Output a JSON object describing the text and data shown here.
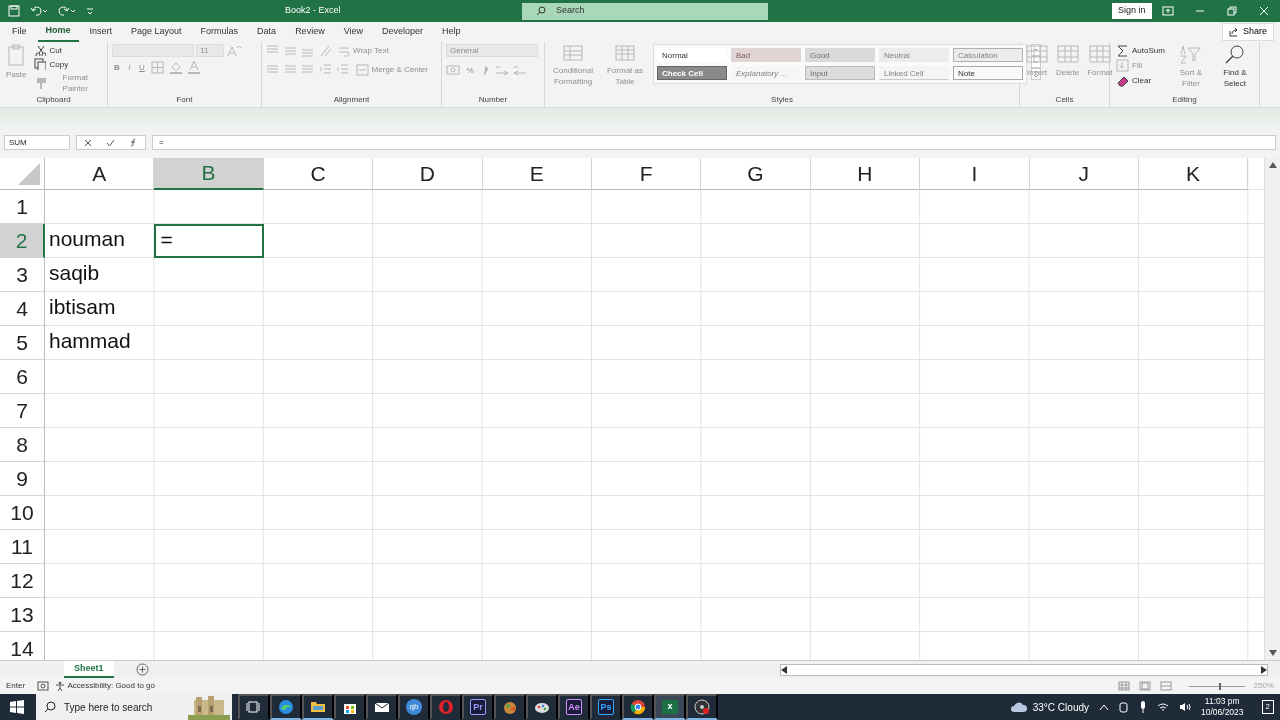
{
  "title_bar": {
    "title": "Book2  -  Excel",
    "search_placeholder": "Search",
    "sign_in": "Sign in"
  },
  "menu_tabs": [
    {
      "label": "File",
      "selected": false
    },
    {
      "label": "Home",
      "selected": true
    },
    {
      "label": "Insert",
      "selected": false
    },
    {
      "label": "Page Layout",
      "selected": false
    },
    {
      "label": "Formulas",
      "selected": false
    },
    {
      "label": "Data",
      "selected": false
    },
    {
      "label": "Review",
      "selected": false
    },
    {
      "label": "View",
      "selected": false
    },
    {
      "label": "Developer",
      "selected": false
    },
    {
      "label": "Help",
      "selected": false
    }
  ],
  "share": "Share",
  "ribbon": {
    "groups": [
      {
        "kind": "clipboard",
        "label": "Clipboard",
        "items": [
          {
            "label": "Paste",
            "disabled": true
          },
          {
            "label": "Cut",
            "disabled": false
          },
          {
            "label": "Copy",
            "disabled": false
          },
          {
            "label": "Format Painter",
            "disabled": true
          }
        ]
      },
      {
        "kind": "font",
        "label": "Font",
        "font_size": "11",
        "format_buttons": [
          "B",
          "I",
          "U"
        ],
        "disabled": true
      },
      {
        "kind": "alignment",
        "label": "Alignment",
        "wrap_text": "Wrap Text",
        "merge": "Merge & Center",
        "disabled": true
      },
      {
        "kind": "number",
        "label": "Number",
        "format": "General",
        "percent": "%",
        "disabled": true
      },
      {
        "kind": "styles",
        "label": "Styles",
        "commands": [
          "Conditional Formatting",
          "Format as Table"
        ],
        "disabled": true,
        "cell_styles": [
          {
            "kind": "normal",
            "label": "Normal"
          },
          {
            "kind": "bad",
            "label": "Bad"
          },
          {
            "kind": "good",
            "label": "Good"
          },
          {
            "kind": "neutral",
            "label": "Neutral"
          },
          {
            "kind": "calculation",
            "label": "Calculation"
          },
          {
            "kind": "check",
            "label": "Check Cell"
          },
          {
            "kind": "explanatory",
            "label": "Explanatory ..."
          },
          {
            "kind": "input",
            "label": "Input"
          },
          {
            "kind": "linked",
            "label": "Linked Cell"
          },
          {
            "kind": "note",
            "label": "Note"
          }
        ]
      },
      {
        "kind": "cells",
        "label": "Cells",
        "items": [
          {
            "label": "Insert",
            "disabled": true
          },
          {
            "label": "Delete",
            "disabled": true
          },
          {
            "label": "Format",
            "disabled": true
          }
        ]
      },
      {
        "kind": "editing",
        "label": "Editing",
        "items": [
          {
            "label": "AutoSum",
            "disabled": false
          },
          {
            "label": "Fill",
            "disabled": true
          },
          {
            "label": "Clear",
            "disabled": false
          },
          {
            "label": "Sort & Filter",
            "disabled": true
          },
          {
            "label": "Find & Select",
            "disabled": false
          }
        ]
      }
    ]
  },
  "formula_bar": {
    "name_box": "SUM",
    "formula": "="
  },
  "sheet": {
    "columns": [
      {
        "label": "A",
        "selected": false
      },
      {
        "label": "B",
        "selected": true
      },
      {
        "label": "C",
        "selected": false
      },
      {
        "label": "D",
        "selected": false
      },
      {
        "label": "E",
        "selected": false
      },
      {
        "label": "F",
        "selected": false
      },
      {
        "label": "G",
        "selected": false
      },
      {
        "label": "H",
        "selected": false
      },
      {
        "label": "I",
        "selected": false
      },
      {
        "label": "J",
        "selected": false
      },
      {
        "label": "K",
        "selected": false
      }
    ],
    "rows": [
      {
        "label": "1"
      },
      {
        "label": "2",
        "cells": {
          "A": {
            "value": "nouman",
            "active": false
          },
          "B": {
            "value": "=",
            "active": true
          }
        }
      },
      {
        "label": "3",
        "cells": {
          "A": {
            "value": "saqib",
            "active": false
          }
        }
      },
      {
        "label": "4",
        "cells": {
          "A": {
            "value": "ibtisam",
            "active": false
          }
        }
      },
      {
        "label": "5",
        "cells": {
          "A": {
            "value": "hammad",
            "active": false
          }
        }
      },
      {
        "label": "6"
      },
      {
        "label": "7"
      },
      {
        "label": "8"
      },
      {
        "label": "9"
      },
      {
        "label": "10"
      },
      {
        "label": "11"
      },
      {
        "label": "12"
      },
      {
        "label": "13"
      },
      {
        "label": "14"
      }
    ]
  },
  "sheet_tabs": [
    {
      "label": "Sheet1",
      "selected": true
    }
  ],
  "status_bar": {
    "mode": "Enter",
    "accessibility": "Accessibility: Good to go",
    "zoom": {
      "level": 0.55,
      "reading": "250%"
    }
  },
  "taskbar": {
    "search_placeholder": "Type here to search",
    "apps": [
      {
        "kind": "taskview",
        "running": false,
        "selected": false
      },
      {
        "kind": "edge",
        "running": true,
        "selected": false
      },
      {
        "kind": "folder",
        "running": true,
        "selected": false
      },
      {
        "kind": "store",
        "running": false,
        "selected": false
      },
      {
        "kind": "mail",
        "running": false,
        "selected": false
      },
      {
        "kind": "torrent",
        "label": "qb",
        "running": false,
        "selected": false
      },
      {
        "kind": "opera",
        "running": false,
        "selected": false
      },
      {
        "kind": "adobe",
        "label": "Pr",
        "color": "#9999ff",
        "running": false,
        "selected": false
      },
      {
        "kind": "blob",
        "running": false,
        "selected": false
      },
      {
        "kind": "palette",
        "running": false,
        "selected": false
      },
      {
        "kind": "adobe",
        "label": "Ae",
        "color": "#d291ff",
        "running": false,
        "selected": false
      },
      {
        "kind": "adobe",
        "label": "Ps",
        "color": "#31a8ff",
        "running": false,
        "selected": false
      },
      {
        "kind": "chrome",
        "running": true,
        "selected": false
      },
      {
        "kind": "excel",
        "label": "x",
        "running": true,
        "selected": true
      },
      {
        "kind": "record",
        "running": true,
        "selected": false
      }
    ],
    "weather": "33°C  Cloudy",
    "time": "11:03 pm",
    "date": "10/06/2023",
    "notifications": "2"
  }
}
